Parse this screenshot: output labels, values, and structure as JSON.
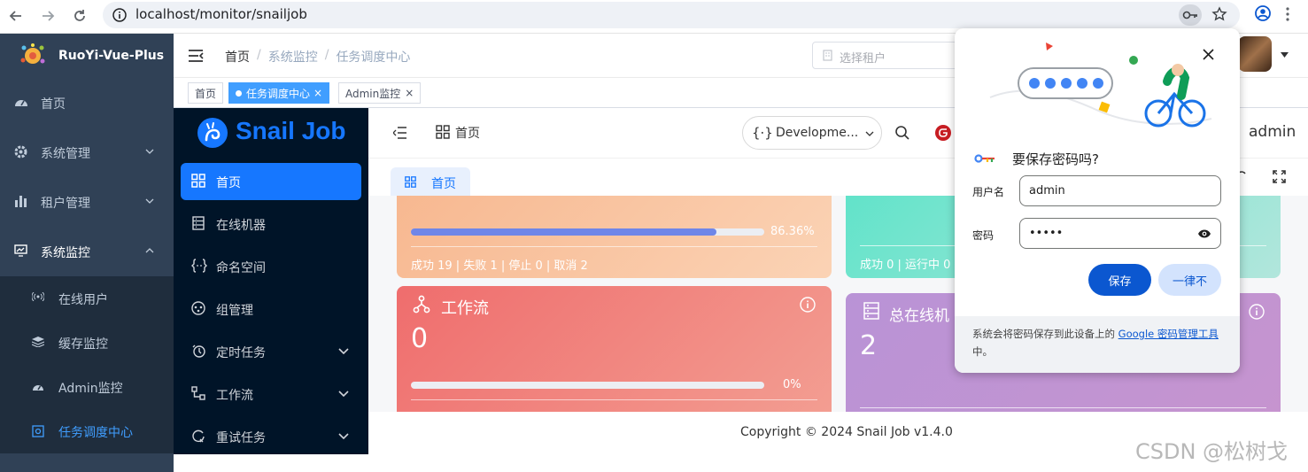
{
  "browser": {
    "url": "localhost/monitor/snailjob",
    "icons": [
      "back-arrow-icon",
      "forward-arrow-icon",
      "reload-icon",
      "site-info-icon",
      "key-icon",
      "star-icon",
      "profile-icon"
    ]
  },
  "ruoyi": {
    "app_name": "RuoYi-Vue-Plus",
    "menu": {
      "home": "首页",
      "system": "系统管理",
      "tenant": "租户管理",
      "monitor": "系统监控"
    },
    "submenu": {
      "online": "在线用户",
      "cache": "缓存监控",
      "admin": "Admin监控",
      "job_center": "任务调度中心"
    },
    "breadcrumb": [
      "首页",
      "系统监控",
      "任务调度中心"
    ],
    "tenant_select_placeholder": "选择租户",
    "tags": {
      "home": "首页",
      "job_center": "任务调度中心",
      "admin": "Admin监控"
    }
  },
  "snailjob": {
    "brand": "Snail Job",
    "menu": {
      "home": "首页",
      "machines": "在线机器",
      "namespace": "命名空间",
      "group": "组管理",
      "timer": "定时任务",
      "workflow": "工作流",
      "retry": "重试任务"
    },
    "header": {
      "home": "首页",
      "namespace_select": "Developme...",
      "user": "admin"
    },
    "tab_home": "首页",
    "cards": {
      "task": {
        "percent_text": "86.36%",
        "progress": 0.8636,
        "stats": "成功 19 | 失败 1 | 停止 0 | 取消 2"
      },
      "online_stats": "成功 0 | 运行中 0",
      "workflow": {
        "title": "工作流",
        "value": "0",
        "percent_text": "0%",
        "progress": 0
      },
      "total_online": {
        "title": "总在线机",
        "value": "2"
      }
    },
    "footer": "Copyright © 2024 Snail Job v1.4.0"
  },
  "password_popup": {
    "title": "要保存密码吗?",
    "username_label": "用户名",
    "username_value": "admin",
    "password_label": "密码",
    "password_value": "•••••",
    "save_button": "保存",
    "never_button": "一律不",
    "footer_text": "系统会将密码保存到此设备上的 ",
    "footer_link": "Google 密码管理工具",
    "footer_tail": "中。"
  },
  "watermark": "CSDN @松树戈",
  "colors": {
    "ry_sidebar": "#304156",
    "ry_active": "#409eff",
    "sj_sider": "#001428",
    "sj_active": "#1677ff",
    "card_orange": "#f8c49c",
    "card_red": "#ee7b7b",
    "card_teal": "#6ee0c9",
    "card_purple": "#c293d6",
    "google_blue": "#0b57d0"
  }
}
